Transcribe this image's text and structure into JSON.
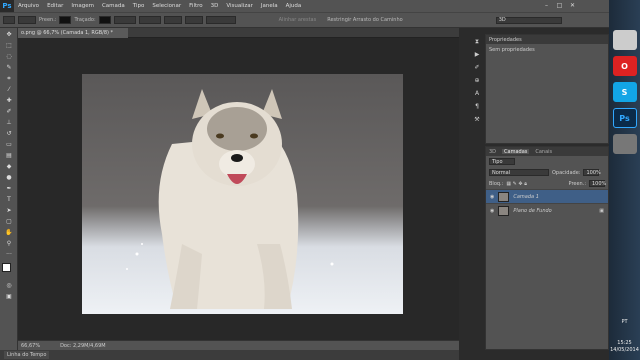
{
  "app": {
    "logo": "Ps"
  },
  "menu": [
    "Arquivo",
    "Editar",
    "Imagem",
    "Camada",
    "Tipo",
    "Selecionar",
    "Filtro",
    "3D",
    "Visualizar",
    "Janela",
    "Ajuda"
  ],
  "window_controls": {
    "minimize": "–",
    "restore": "□",
    "close": "✕"
  },
  "options": {
    "fill_label": "Preen.:",
    "stroke_label": "Traçado:",
    "align_edges": "Alinhar arestas",
    "constrain": "Restringir Arrasto do Caminho",
    "workspace": "3D"
  },
  "document": {
    "tab": "o.png @ 66,7% (Camada 1, RGB/8) *",
    "zoom": "66,67%",
    "doc_info": "Doc: 2,29M/4,69M"
  },
  "timeline_tab": "Linha do Tempo",
  "properties": {
    "tab": "Propriedades",
    "content": "Sem propriedades"
  },
  "layers_panel": {
    "tabs": [
      "3D",
      "Camadas",
      "Canais"
    ],
    "filter": "Tipo",
    "blend_mode": "Normal",
    "opacity_label": "Opacidade:",
    "opacity": "100%",
    "lock_label": "Bloq.:",
    "fill_label": "Preen.:",
    "fill": "100%",
    "layers": [
      {
        "name": "Camada 1",
        "active": true
      },
      {
        "name": "Plano de Fundo",
        "active": false
      }
    ]
  },
  "taskbar": {
    "time": "15:25",
    "date": "14/05/2014",
    "lang": "PT",
    "ps_label": "Ps",
    "skype_label": "S"
  }
}
